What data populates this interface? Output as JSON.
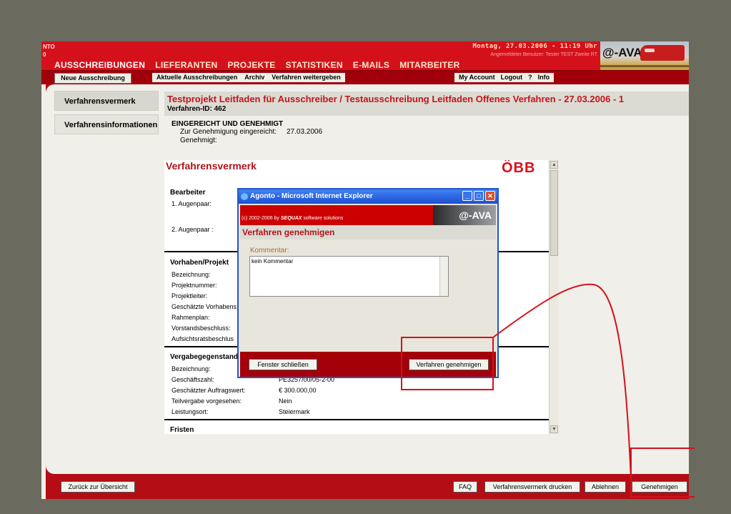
{
  "header": {
    "nto_text": "NTO\n0",
    "datetime": "Montag, 27.03.2006 - 11:19 Uhr",
    "user_line": "Angemeldeter Benutzer: Tester TEST Zweite RT",
    "logo_text": "@-AVA",
    "main_nav": [
      "AUSSCHREIBUNGEN",
      "LIEFERANTEN",
      "PROJEKTE",
      "STATISTIKEN",
      "E-MAILS",
      "MITARBEITER"
    ],
    "sub_button": "Neue Ausschreibung",
    "sub_links": [
      "Aktuelle Ausschreibungen",
      "Archiv",
      "Verfahren weitergeben"
    ],
    "right_links": [
      "My Account",
      "Logout",
      "?",
      "Info"
    ]
  },
  "sidebar": {
    "items": [
      {
        "label": "Verfahrensvermerk"
      },
      {
        "label": "Verfahrensinformationen"
      }
    ]
  },
  "content": {
    "title": "Testprojekt Leitfaden für Ausschreiber / Testausschreibung Leitfaden Offenes Verfahren - 27.03.2006 - 1",
    "id_line": "Verfahren-ID: 462",
    "status_title": "EINGEREICHT UND GENEHMIGT",
    "submitted_label": "Zur Genehmigung eingereicht:",
    "submitted_value": "27.03.2006",
    "approved_label": "Genehmigt:",
    "document": {
      "title": "Verfahrensvermerk",
      "logo": "ÖBB",
      "bearbeiter": {
        "heading": "Bearbeiter",
        "rows": [
          "1. Augenpaar:",
          "2. Augenpaar :"
        ]
      },
      "vorhaben": {
        "heading": "Vorhaben/Projekt",
        "rows": [
          "Bezeichnung:",
          "Projektnummer:",
          "Projektleiter:",
          "Geschätzte Vorhabens",
          "Rahmenplan:",
          "Vorstandsbeschluss:",
          "Aufsichtsratsbeschlus"
        ]
      },
      "vergabe": {
        "heading": "Vergabegegenstand",
        "rows": [
          {
            "label": "Bezeichnung:",
            "value": ""
          },
          {
            "label": "Geschäftszahl:",
            "value": "PE3257/00/05-2-00"
          },
          {
            "label": "Geschätzter Auftragswert:",
            "value": "€ 300.000,00"
          },
          {
            "label": "Teilvergabe vorgesehen:",
            "value": "Nein"
          },
          {
            "label": "Leistungsort:",
            "value": "Steiermark"
          }
        ]
      },
      "fristen_heading": "Fristen"
    }
  },
  "footer": {
    "back_button": "Zurück zur Übersicht",
    "buttons": [
      "FAQ",
      "Verfahrensvermerk drucken",
      "Ablehnen",
      "Genehmigen"
    ]
  },
  "dialog": {
    "title": "Agonto - Microsoft Internet Explorer",
    "copyright": "(c) 2002-2006 by",
    "copyright_brand": "SEQUAX",
    "copyright_tail": "software solutions",
    "logo_text": "@-AVA",
    "heading": "Verfahren genehmigen",
    "comment_label": "Kommentar:",
    "comment_value": "kein Kommentar",
    "close_button": "Fenster schließen",
    "approve_button": "Verfahren genehmigen"
  },
  "colors": {
    "brand_red": "#d4111b",
    "dark_red": "#a1000a",
    "title_red": "#c3151c",
    "annotation_red": "#d4111b",
    "xp_blue": "#2456c8"
  }
}
